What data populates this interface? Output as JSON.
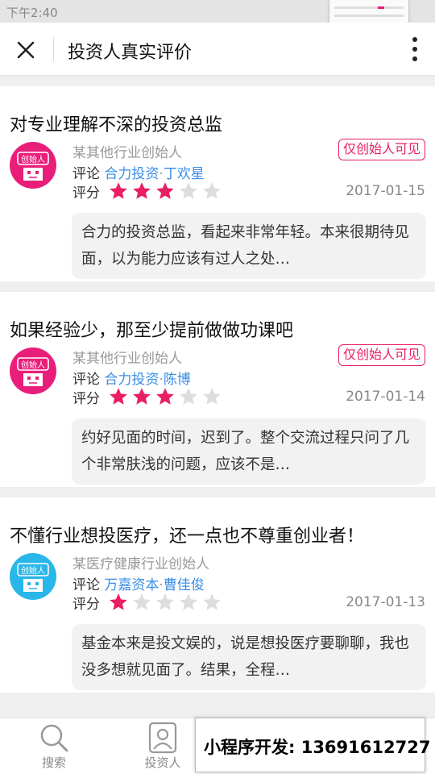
{
  "status_bar": {
    "time": "下午2:40"
  },
  "header": {
    "title": "投资人真实评价",
    "close_icon": "close-icon",
    "more_icon": "more-vertical-icon"
  },
  "colors": {
    "accent": "#e91e63",
    "link": "#3a8ee6",
    "avatar_pink": "#e91e7a",
    "avatar_cyan": "#29b6e8",
    "star_off": "#dddddd"
  },
  "reviews": [
    {
      "title": "对专业理解不深的投资总监",
      "author": "某其他行业创始人",
      "badge": "仅创始人可见",
      "comment_label": "评论",
      "firm": "合力投资",
      "separator": "·",
      "investor": "丁欢星",
      "rating_label": "评分",
      "rating": 3,
      "date": "2017-01-15",
      "text": "合力的投资总监，看起来非常年轻。本来很期待见面，以为能力应该有过人之处…",
      "avatar_label": "创始人",
      "avatar_color": "pink"
    },
    {
      "title": "如果经验少，那至少提前做做功课吧",
      "author": "某其他行业创始人",
      "badge": "仅创始人可见",
      "comment_label": "评论",
      "firm": "合力投资",
      "separator": "·",
      "investor": "陈博",
      "rating_label": "评分",
      "rating": 3,
      "date": "2017-01-14",
      "text": "约好见面的时间，迟到了。整个交流过程只问了几个非常肤浅的问题，应该不是…",
      "avatar_label": "创始人",
      "avatar_color": "pink"
    },
    {
      "title": "不懂行业想投医疗，还一点也不尊重创业者！",
      "author": "某医疗健康行业创始人",
      "badge": "",
      "comment_label": "评论",
      "firm": "万嘉资本",
      "separator": "·",
      "investor": "曹佳俊",
      "rating_label": "评分",
      "rating": 1,
      "date": "2017-01-13",
      "text": "基金本来是投文娱的，说是想投医疗要聊聊，我也没多想就见面了。结果，全程…",
      "avatar_label": "创始人",
      "avatar_color": "cyan"
    }
  ],
  "tabs": [
    {
      "label": "搜索",
      "icon": "search-icon"
    },
    {
      "label": "投资人",
      "icon": "investor-profile-icon"
    }
  ],
  "promo": {
    "text": "小程序开发: 13691612727"
  }
}
